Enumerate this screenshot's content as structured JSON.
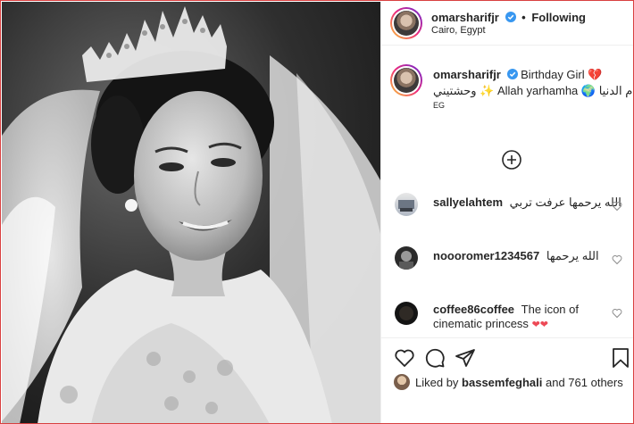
{
  "post": {
    "author": "omarsharifjr",
    "follow_label": "Following",
    "location": "Cairo, Egypt",
    "separator": "•"
  },
  "caption": {
    "author": "omarsharifjr",
    "text_line1": "Birthday Girl ❤️‍🩹",
    "text_line1_plain": "Birthday Girl",
    "text_line1_ar": "أم الدنيا",
    "text_line1_en": "Allah yarhamha",
    "text_line2_ar": "وحشتيني",
    "sparkle": "✨",
    "globe": "🌍",
    "broken_heart": "💔",
    "country": "EG"
  },
  "comments": [
    {
      "user": "sallyelahtem",
      "text": "الله يرحمها عرفت تربي"
    },
    {
      "user": "noooromer1234567",
      "text": "الله يرحمها"
    },
    {
      "user": "coffee86coffee",
      "text_line1": "The icon of",
      "text_line2": "cinematic princess",
      "hearts": "❤❤"
    }
  ],
  "likes": {
    "prefix": "Liked by",
    "user": "bassemfeghali",
    "suffix": "and 761 others"
  },
  "colors": {
    "verified": "#3897f0",
    "heart": "#ed4956",
    "border": "#efefef",
    "frame": "#d94040"
  },
  "icons": [
    "verified-icon",
    "add-more-comments-icon",
    "heart-icon",
    "comment-icon",
    "share-icon",
    "bookmark-icon"
  ]
}
